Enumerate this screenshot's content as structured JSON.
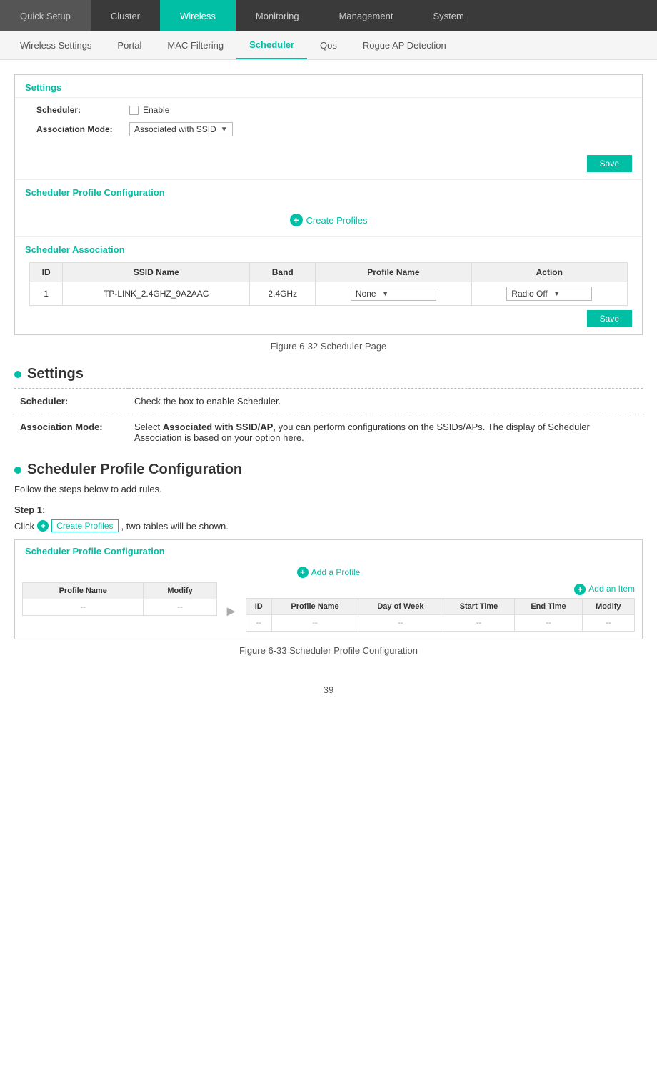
{
  "topNav": {
    "items": [
      {
        "label": "Quick Setup",
        "active": false
      },
      {
        "label": "Cluster",
        "active": false
      },
      {
        "label": "Wireless",
        "active": true
      },
      {
        "label": "Monitoring",
        "active": false
      },
      {
        "label": "Management",
        "active": false
      },
      {
        "label": "System",
        "active": false
      }
    ]
  },
  "subNav": {
    "items": [
      {
        "label": "Wireless Settings",
        "active": false
      },
      {
        "label": "Portal",
        "active": false
      },
      {
        "label": "MAC Filtering",
        "active": false
      },
      {
        "label": "Scheduler",
        "active": true
      },
      {
        "label": "Qos",
        "active": false
      },
      {
        "label": "Rogue AP Detection",
        "active": false
      }
    ]
  },
  "screenshot1": {
    "settings": {
      "title": "Settings",
      "schedulerLabel": "Scheduler:",
      "schedulerValue": "Enable",
      "associationLabel": "Association Mode:",
      "associationValue": "Associated with SSID",
      "saveBtn": "Save"
    },
    "profileConfig": {
      "title": "Scheduler Profile Configuration",
      "createProfilesLabel": "Create Profiles"
    },
    "schedulerAssociation": {
      "title": "Scheduler Association",
      "columns": [
        "ID",
        "SSID Name",
        "Band",
        "Profile Name",
        "Action"
      ],
      "rows": [
        {
          "id": "1",
          "ssidName": "TP-LINK_2.4GHZ_9A2AAC",
          "band": "2.4GHz",
          "profileName": "None",
          "action": "Radio Off"
        }
      ],
      "saveBtn": "Save"
    }
  },
  "figureCaption1": "Figure 6-32 Scheduler Page",
  "docSection1": {
    "title": "Settings",
    "rows": [
      {
        "label": "Scheduler:",
        "description": "Check the box to enable Scheduler."
      },
      {
        "label": "Association Mode:",
        "description": "Select Associated with SSID/AP, you can perform configurations on the SSIDs/APs. The display of Scheduler Association is based on your option here."
      }
    ]
  },
  "docSection2": {
    "title": "Scheduler Profile Configuration",
    "intro": "Follow the steps below to add rules.",
    "step1Label": "Step 1:",
    "step1Text1": "Click",
    "step1CreateProfiles": "Create Profiles",
    "step1Text2": ", two tables will be shown."
  },
  "screenshot2": {
    "profileConfig": {
      "title": "Scheduler Profile Configuration",
      "addProfileLabel": "Add a Profile",
      "leftTable": {
        "columns": [
          "Profile Name",
          "Modify"
        ],
        "rows": [
          {
            "profileName": "--",
            "modify": "--"
          }
        ]
      },
      "addItemLabel": "Add an Item",
      "rightTable": {
        "columns": [
          "ID",
          "Profile Name",
          "Day of Week",
          "Start Time",
          "End Time",
          "Modify"
        ],
        "rows": [
          {
            "id": "--",
            "profileName": "--",
            "dayOfWeek": "--",
            "startTime": "--",
            "endTime": "--",
            "modify": "--"
          }
        ]
      }
    }
  },
  "figureCaption2": "Figure 6-33 Scheduler Profile Configuration",
  "pageNumber": "39"
}
